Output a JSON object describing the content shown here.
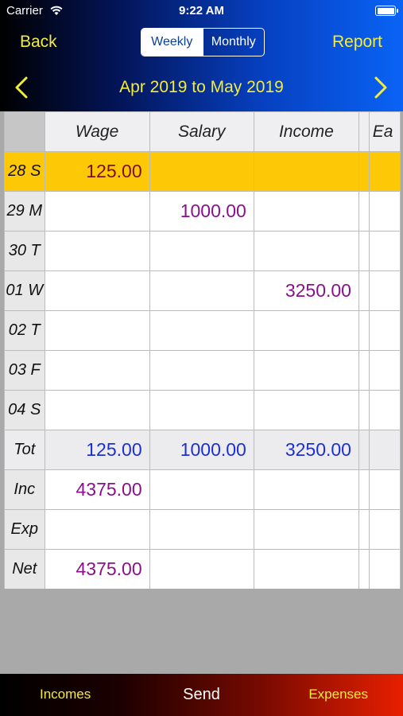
{
  "status_bar": {
    "carrier": "Carrier",
    "time": "9:22 AM"
  },
  "nav": {
    "back_label": "Back",
    "report_label": "Report",
    "segments": {
      "weekly": "Weekly",
      "monthly": "Monthly",
      "selected": "Weekly"
    },
    "date_range": "Apr 2019 to May 2019"
  },
  "table": {
    "columns": [
      "Wage",
      "Salary",
      "Income",
      "Ea"
    ],
    "rows": [
      {
        "label": "28 S",
        "values": [
          "125.00",
          "",
          "",
          ""
        ]
      },
      {
        "label": "29 M",
        "values": [
          "",
          "1000.00",
          "",
          ""
        ]
      },
      {
        "label": "30 T",
        "values": [
          "",
          "",
          "",
          ""
        ]
      },
      {
        "label": "01 W",
        "values": [
          "",
          "",
          "3250.00",
          ""
        ]
      },
      {
        "label": "02 T",
        "values": [
          "",
          "",
          "",
          ""
        ]
      },
      {
        "label": "03 F",
        "values": [
          "",
          "",
          "",
          ""
        ]
      },
      {
        "label": "04 S",
        "values": [
          "",
          "",
          "",
          ""
        ]
      }
    ],
    "totals": {
      "label": "Tot",
      "values": [
        "125.00",
        "1000.00",
        "3250.00",
        ""
      ]
    },
    "summary": [
      {
        "label": "Inc",
        "value": "4375.00"
      },
      {
        "label": "Exp",
        "value": ""
      },
      {
        "label": "Net",
        "value": "4375.00"
      }
    ]
  },
  "tabbar": {
    "incomes": "Incomes",
    "send": "Send",
    "expenses": "Expenses"
  },
  "colors": {
    "highlight_row": "#fdc805",
    "value_purple": "#8a108c",
    "total_blue": "#1b2fd6",
    "nav_yellow": "#f4ec3a"
  }
}
